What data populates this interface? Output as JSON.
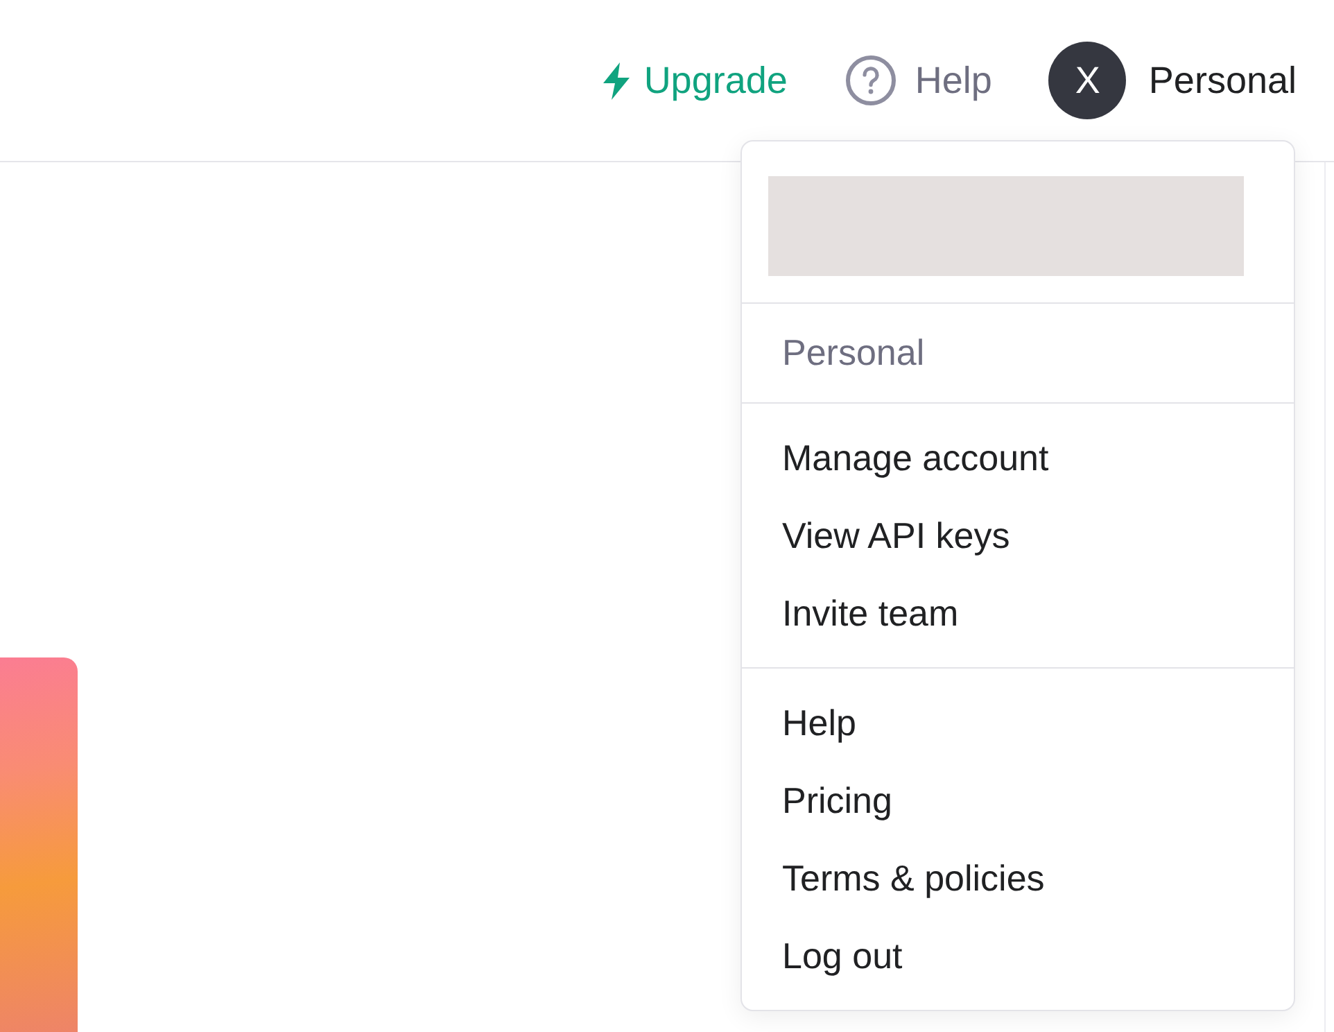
{
  "header": {
    "upgrade_link": "Upgrade",
    "help_link": "Help",
    "account": {
      "avatar_initial": "X",
      "name": "Personal"
    }
  },
  "account_menu": {
    "expanded": true,
    "organization": "Personal",
    "groups": [
      {
        "items": [
          {
            "label": "Manage account"
          },
          {
            "label": "View API keys"
          },
          {
            "label": "Invite team"
          }
        ]
      },
      {
        "items": [
          {
            "label": "Help"
          },
          {
            "label": "Pricing"
          },
          {
            "label": "Terms & policies"
          },
          {
            "label": "Log out"
          }
        ]
      }
    ]
  }
}
